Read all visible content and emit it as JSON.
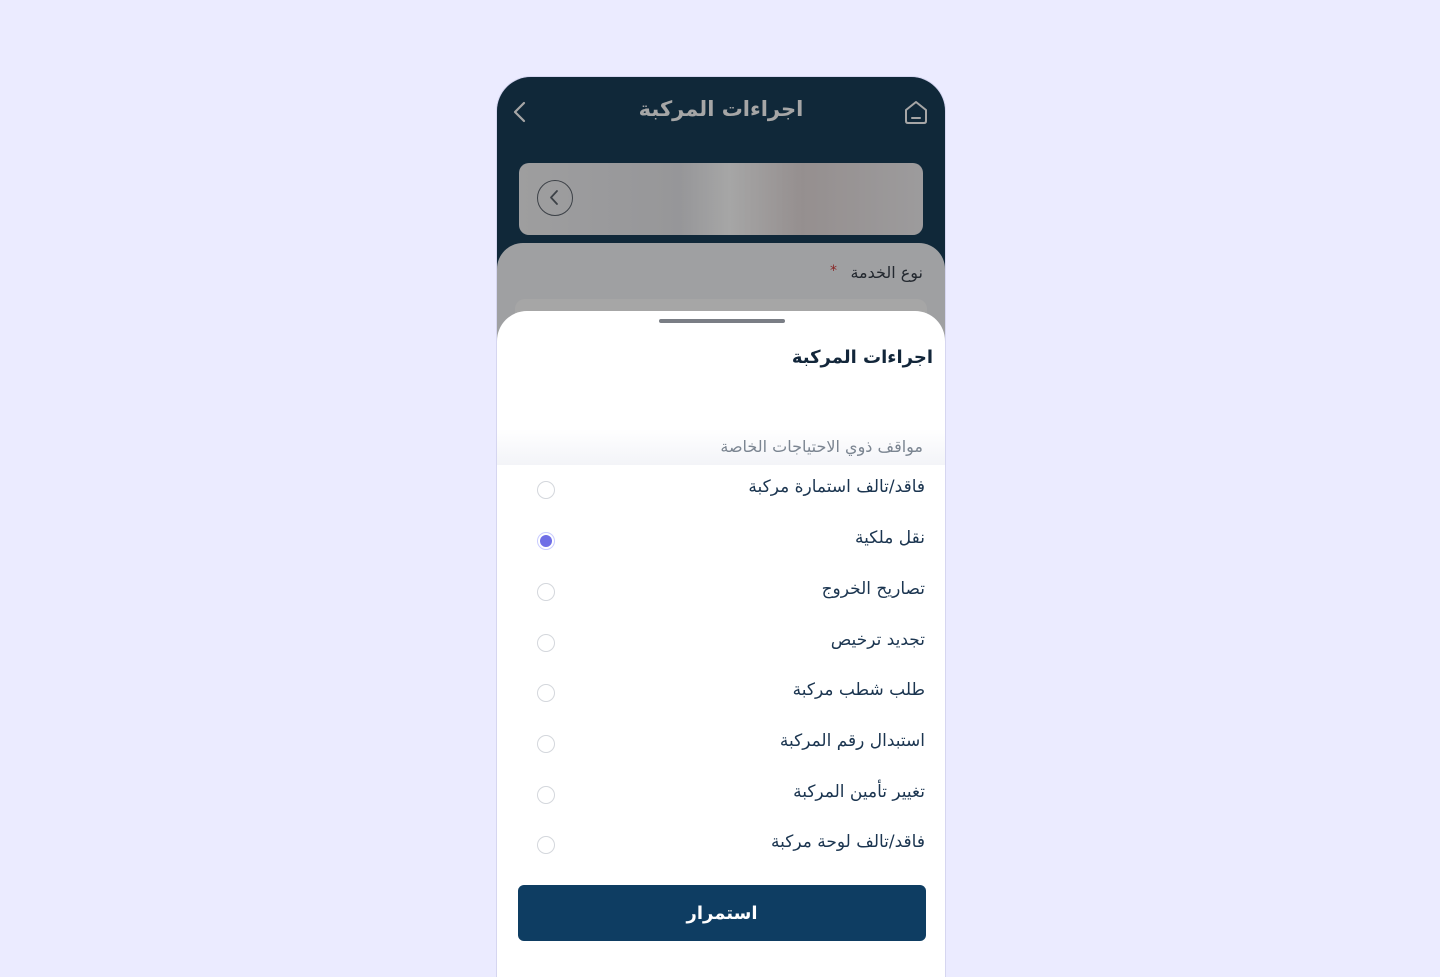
{
  "header": {
    "title": "اجراءات المركبة",
    "back_icon": "chevron-left-icon",
    "home_icon": "home-icon"
  },
  "form": {
    "service_type_label": "نوع الخدمة",
    "required_mark": "*"
  },
  "sheet": {
    "title": "اجراءات المركبة",
    "faded_option": "مواقف ذوي الاحتياجات الخاصة",
    "options": [
      {
        "label": "فاقد/تالف استمارة مركبة",
        "selected": false
      },
      {
        "label": "نقل ملكية",
        "selected": true
      },
      {
        "label": "تصاريح الخروج",
        "selected": false
      },
      {
        "label": "تجديد ترخيص",
        "selected": false
      },
      {
        "label": "طلب شطب مركبة",
        "selected": false
      },
      {
        "label": "استبدال رقم المركبة",
        "selected": false
      },
      {
        "label": "تغيير تأمين المركبة",
        "selected": false
      },
      {
        "label": "فاقد/تالف لوحة مركبة",
        "selected": false
      }
    ],
    "continue_label": "استمرار"
  },
  "colors": {
    "primary_dark": "#0e3450",
    "button": "#0e3d62",
    "radio_selected": "#6f6ee6",
    "background": "#ebebff"
  }
}
